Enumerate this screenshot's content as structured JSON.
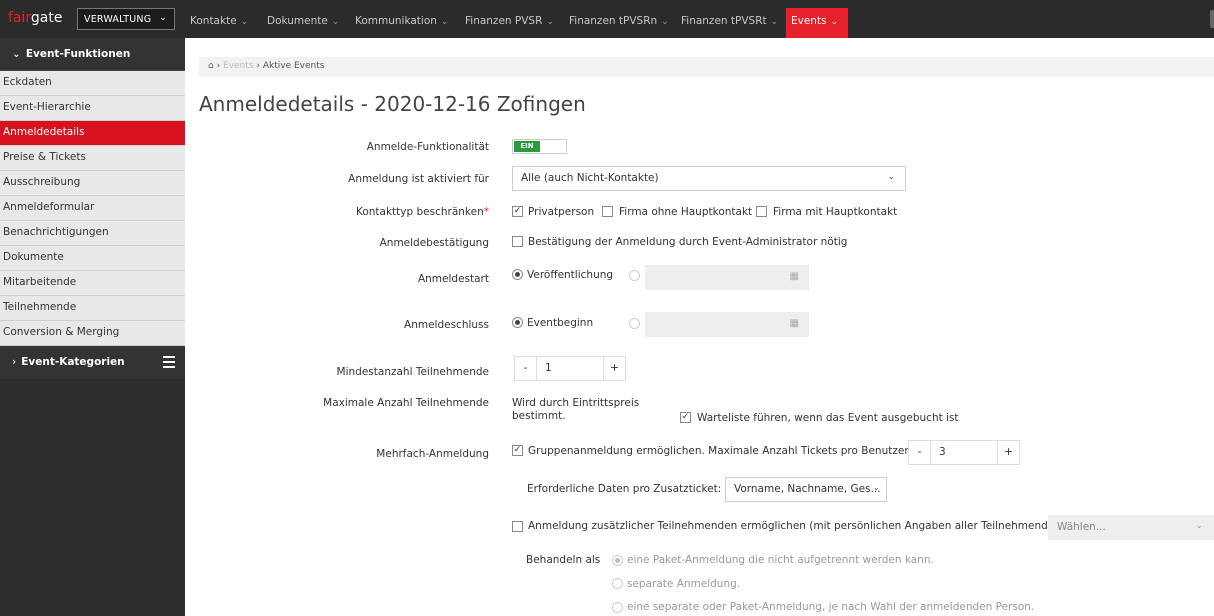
{
  "topbar": {
    "logo_fair": "fair",
    "logo_gate": "gate",
    "org_selector": "VERWALTUNG",
    "nav": [
      "Kontakte",
      "Dokumente",
      "Kommunikation",
      "Finanzen PVSR",
      "Finanzen tPVSRn",
      "Finanzen tPVSRt",
      "Events"
    ],
    "active_nav": "Events",
    "accent_color": "#e5212b"
  },
  "sidebar": {
    "section1": "Event-Funktionen",
    "items": [
      "Eckdaten",
      "Event-Hierarchie",
      "Anmeldedetails",
      "Preise & Tickets",
      "Ausschreibung",
      "Anmeldeformular",
      "Benachrichtigungen",
      "Dokumente",
      "Mitarbeitende",
      "Teilnehmende",
      "Conversion & Merging"
    ],
    "active_item": "Anmeldedetails",
    "section2": "Event-Kategorien"
  },
  "breadcrumb": {
    "home_icon": "home-icon",
    "level1": "Events",
    "current": "Aktive Events"
  },
  "page": {
    "title": "Anmeldedetails - 2020-12-16 Zofingen"
  },
  "form": {
    "funktionalitaet": {
      "label": "Anmelde-Funktionalität",
      "toggle": "EIN"
    },
    "aktiviert_fuer": {
      "label": "Anmeldung ist aktiviert für",
      "value": "Alle (auch Nicht-Kontakte)"
    },
    "kontakttyp": {
      "label": "Kontakttyp beschränken",
      "required_mark": "*",
      "options": [
        {
          "label": "Privatperson",
          "checked": true
        },
        {
          "label": "Firma ohne Hauptkontakt",
          "checked": false
        },
        {
          "label": "Firma mit Hauptkontakt",
          "checked": false
        }
      ]
    },
    "bestaetigung": {
      "label": "Anmeldebestätigung",
      "option": "Bestätigung der Anmeldung durch Event-Administrator nötig"
    },
    "anmeldestart": {
      "label": "Anmeldestart",
      "option": "Veröffentlichung"
    },
    "anmeldeschluss": {
      "label": "Anmeldeschluss",
      "option": "Eventbeginn"
    },
    "mindestanzahl": {
      "label": "Mindestanzahl Teilnehmende",
      "value": "1",
      "minus": "-",
      "plus": "+"
    },
    "maximal": {
      "label": "Maximale Anzahl Teilnehmende",
      "text_line1": "Wird durch Eintrittspreis",
      "text_line2": "bestimmt.",
      "warteliste": "Warteliste führen, wenn das Event ausgebucht ist"
    },
    "mehrfach": {
      "label": "Mehrfach-Anmeldung",
      "gruppen": "Gruppenanmeldung ermöglichen. Maximale Anzahl Tickets pro Benutzer:",
      "tickets_value": "3",
      "minus": "-",
      "plus": "+",
      "erforderlich_label": "Erforderliche Daten pro Zusatzticket:",
      "erforderlich_value": "Vorname, Nachname, Ges...",
      "zusaetzlich": "Anmeldung zusätzlicher Teilnehmenden ermöglichen (mit persönlichen Angaben aller Teilnehmenden)",
      "waehlen": "Wählen...",
      "behandeln_label": "Behandeln als",
      "behandeln_options": [
        "eine Paket-Anmeldung die nicht aufgetrennt werden kann.",
        "separate Anmeldung.",
        "eine separate oder Paket-Anmeldung, je nach Wahl der anmeldenden Person."
      ]
    }
  }
}
